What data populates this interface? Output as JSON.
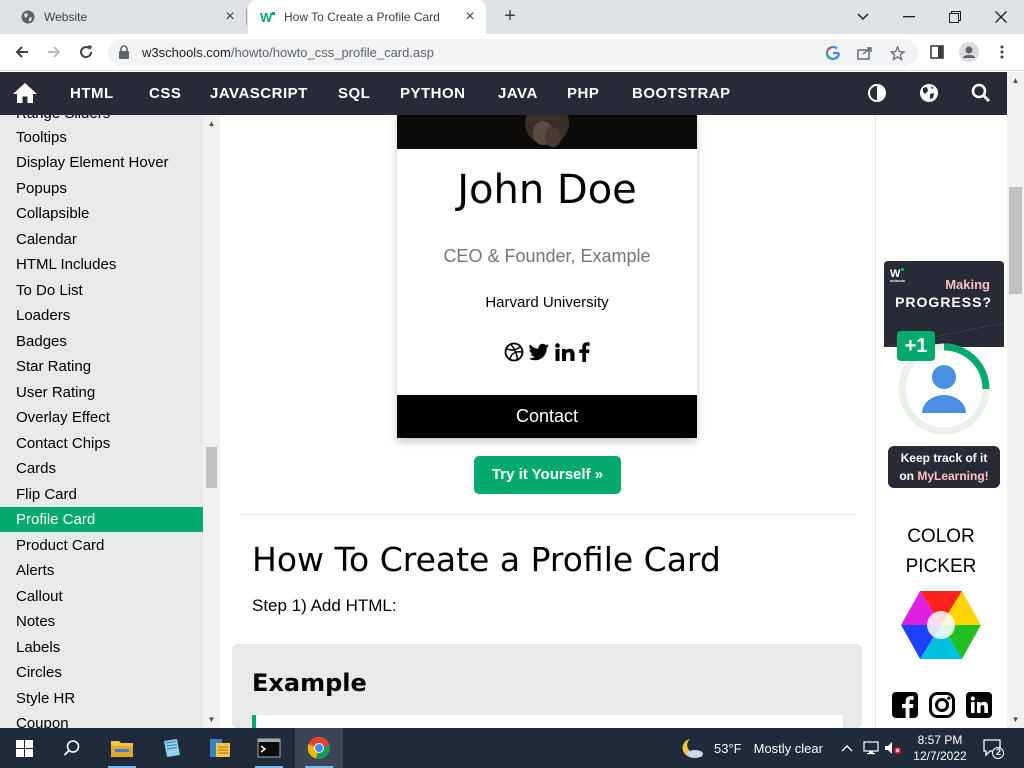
{
  "browser": {
    "tabs": [
      {
        "title": "Website",
        "favicon": "globe-icon",
        "active": false
      },
      {
        "title": "How To Create a Profile Card",
        "favicon": "w3schools-icon",
        "active": true
      }
    ],
    "url_host": "w3schools.com",
    "url_path": "/howto/howto_css_profile_card.asp"
  },
  "nav": {
    "links": [
      "HTML",
      "CSS",
      "JAVASCRIPT",
      "SQL",
      "PYTHON",
      "JAVA",
      "PHP",
      "BOOTSTRAP"
    ]
  },
  "sidebar": {
    "items": [
      {
        "label": "Range Sliders",
        "active": false
      },
      {
        "label": "Tooltips",
        "active": false
      },
      {
        "label": "Display Element Hover",
        "active": false
      },
      {
        "label": "Popups",
        "active": false
      },
      {
        "label": "Collapsible",
        "active": false
      },
      {
        "label": "Calendar",
        "active": false
      },
      {
        "label": "HTML Includes",
        "active": false
      },
      {
        "label": "To Do List",
        "active": false
      },
      {
        "label": "Loaders",
        "active": false
      },
      {
        "label": "Badges",
        "active": false
      },
      {
        "label": "Star Rating",
        "active": false
      },
      {
        "label": "User Rating",
        "active": false
      },
      {
        "label": "Overlay Effect",
        "active": false
      },
      {
        "label": "Contact Chips",
        "active": false
      },
      {
        "label": "Cards",
        "active": false
      },
      {
        "label": "Flip Card",
        "active": false
      },
      {
        "label": "Profile Card",
        "active": true
      },
      {
        "label": "Product Card",
        "active": false
      },
      {
        "label": "Alerts",
        "active": false
      },
      {
        "label": "Callout",
        "active": false
      },
      {
        "label": "Notes",
        "active": false
      },
      {
        "label": "Labels",
        "active": false
      },
      {
        "label": "Circles",
        "active": false
      },
      {
        "label": "Style HR",
        "active": false
      },
      {
        "label": "Coupon",
        "active": false
      }
    ]
  },
  "card": {
    "name": "John Doe",
    "title": "CEO & Founder, Example",
    "school": "Harvard University",
    "socials": [
      "dribbble-icon",
      "twitter-icon",
      "linkedin-icon",
      "facebook-icon"
    ],
    "contact_label": "Contact"
  },
  "main": {
    "try_button": "Try it Yourself »",
    "heading": "How To Create a Profile Card",
    "step": "Step 1) Add HTML:",
    "example_title": "Example"
  },
  "right": {
    "ad_brand": "w3schools",
    "ad_line1": "Making",
    "ad_line2": "PROGRESS?",
    "ad_badge": "+1",
    "ad_keep_1": "Keep track of it",
    "ad_keep_2a": "on ",
    "ad_keep_2b": "MyLearning!",
    "color_picker_1": "COLOR",
    "color_picker_2": "PICKER",
    "socials": [
      "facebook-icon",
      "instagram-icon",
      "linkedin-icon"
    ]
  },
  "taskbar": {
    "temperature": "53°F",
    "weather": "Mostly clear",
    "time": "8:57 PM",
    "date": "12/7/2022",
    "notifications": "2"
  },
  "colors": {
    "brand_green": "#04aa6d",
    "nav_dark": "#282a35",
    "sidebar_bg": "#e7e9eb"
  }
}
